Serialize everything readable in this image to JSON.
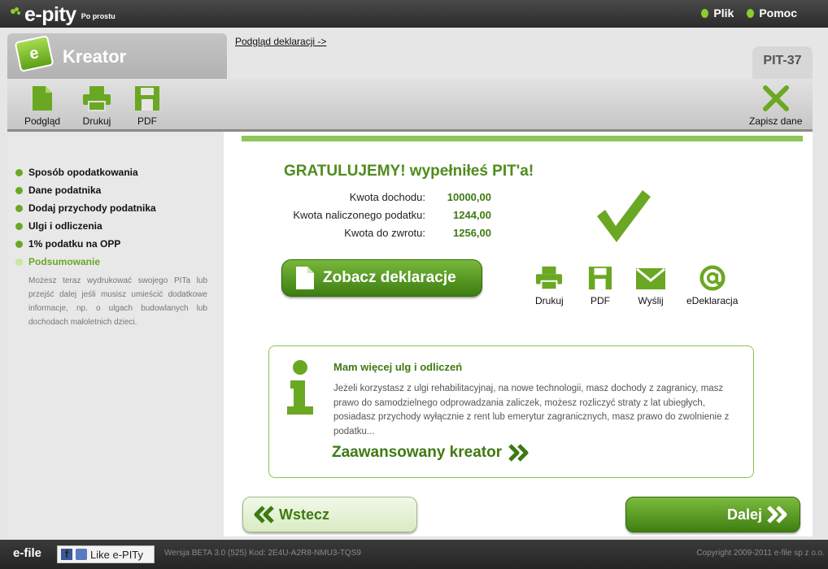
{
  "topbar": {
    "logo_text": "e-pity",
    "logo_tagline": "Po prostu",
    "menu": [
      {
        "label": "Plik"
      },
      {
        "label": "Pomoc"
      }
    ]
  },
  "header": {
    "title": "Kreator",
    "preview_link": "Podgląd deklaracji ->",
    "form_tab": "PIT-37"
  },
  "toolbar": {
    "preview_label": "Podgląd",
    "print_label": "Drukuj",
    "pdf_label": "PDF",
    "save_label": "Zapisz dane"
  },
  "sidebar": {
    "steps": [
      {
        "label": "Sposób opodatkowania"
      },
      {
        "label": "Dane podatnika"
      },
      {
        "label": "Dodaj przychody podatnika"
      },
      {
        "label": "Ulgi i odliczenia"
      },
      {
        "label": "1% podatku na OPP"
      },
      {
        "label": "Podsumowanie",
        "active": true
      }
    ],
    "note": "Możesz teraz wydrukować swojego PITa lub przejść dalej jeśli musisz umieścić dodatkowe informacje, np. o ulgach budowlanych lub dochodach małoletnich dzieci."
  },
  "main": {
    "congrats": "GRATULUJEMY! wypełniłeś PIT'a!",
    "summary": [
      {
        "label": "Kwota dochodu:",
        "value": "10000,00"
      },
      {
        "label": "Kwota naliczonego podatku:",
        "value": "1244,00"
      },
      {
        "label": "Kwota do zwrotu:",
        "value": "1256,00"
      }
    ],
    "view_button": "Zobacz deklaracje",
    "actions": {
      "print": "Drukuj",
      "pdf": "PDF",
      "send": "Wyślij",
      "edeclaration": "eDeklaracja"
    },
    "info": {
      "title": "Mam więcej ulg i odliczeń",
      "text": "Jeżeli korzystasz z ulgi rehabilitacyjnaj, na nowe technologii, masz dochody z zagranicy, masz prawo do samodzielnego odprowadzania zaliczek, możesz rozliczyć straty z lat ubiegłych, posiadasz przychody wyłącznie z rent lub emerytur zagranicznych, masz prawo do zwolnienie z podatku...",
      "advanced_link": "Zaawansowany kreator"
    },
    "back_button": "Wstecz",
    "next_button": "Dalej"
  },
  "footer": {
    "logo": "e-file",
    "like_label": "Like e-PITy",
    "version": "Wersja BETA 3.0 (525)  Kod: 2E4U-A2R8-NMU3-TQS9",
    "copyright": "Copyright 2009-2011 e-file sp z o.o."
  },
  "colors": {
    "accent_green": "#6aa823",
    "dark_green": "#3e7a12",
    "topbar": "#2b2b2b"
  }
}
